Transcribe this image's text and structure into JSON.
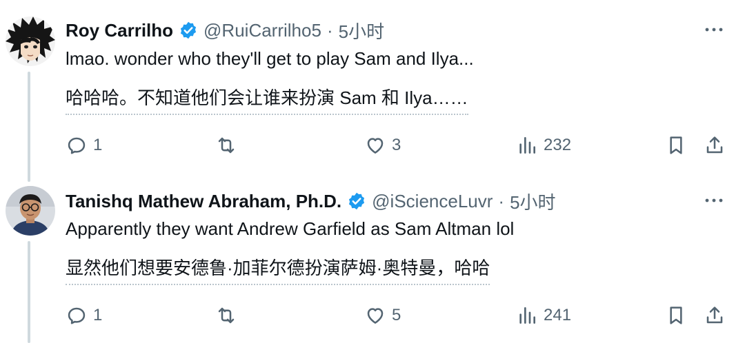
{
  "tweets": [
    {
      "name": "Roy Carrilho",
      "handle": "@RuiCarrilho5",
      "separator": "·",
      "time": "5小时",
      "text": "lmao. wonder who they'll get to play Sam and Ilya...",
      "translation": "哈哈哈。不知道他们会让谁来扮演 Sam 和 Ilya……",
      "reply_count": "1",
      "retweet_count": "",
      "like_count": "3",
      "view_count": "232",
      "avatar_icon": "anime-character-avatar"
    },
    {
      "name": "Tanishq Mathew Abraham, Ph.D.",
      "handle": "@iScienceLuvr",
      "separator": "·",
      "time": "5小时",
      "text": "Apparently they want Andrew Garfield as Sam Altman lol",
      "translation": "显然他们想要安德鲁·加菲尔德扮演萨姆·奥特曼，哈哈",
      "reply_count": "1",
      "retweet_count": "",
      "like_count": "5",
      "view_count": "241",
      "avatar_icon": "person-photo-avatar"
    }
  ],
  "colors": {
    "verified": "#1d9bf0",
    "secondary_text": "#536471",
    "thread_line": "#cfd9de"
  }
}
